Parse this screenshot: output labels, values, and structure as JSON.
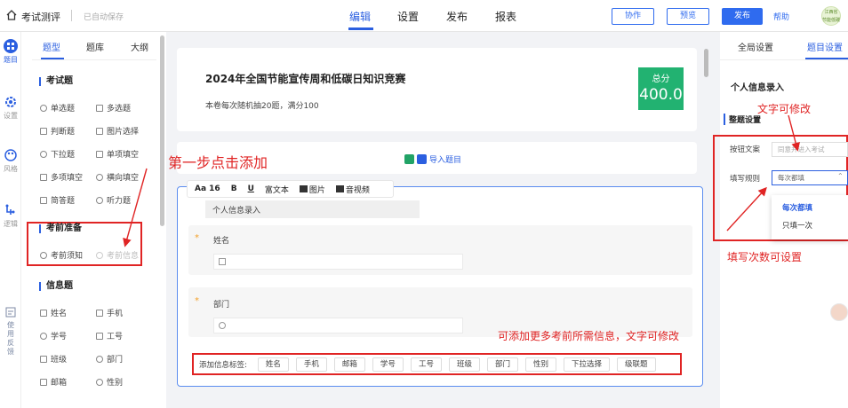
{
  "topbar": {
    "title": "考试测评",
    "saved_status": "已自动保存",
    "nav": [
      "编辑",
      "设置",
      "发布",
      "报表"
    ],
    "active_nav": "编辑",
    "buttons": {
      "collab": "协作",
      "preview": "预览",
      "publish": "发布"
    },
    "help": "帮助",
    "avatar_text": "江西省 节能低碳"
  },
  "rail": [
    {
      "label": "题目",
      "icon": "grid-icon"
    },
    {
      "label": "设置",
      "icon": "gear-icon"
    },
    {
      "label": "风格",
      "icon": "palette-icon"
    },
    {
      "label": "逻辑",
      "icon": "logic-icon"
    }
  ],
  "rail_bottom": "使用反馈",
  "left_panel": {
    "tabs": [
      "题型",
      "题库",
      "大纲"
    ],
    "sections": [
      {
        "title": "考试题",
        "items": [
          "单选题",
          "多选题",
          "判断题",
          "图片选择",
          "下拉题",
          "单项填空",
          "多项填空",
          "横向填空",
          "简答题",
          "听力题"
        ]
      },
      {
        "title": "考前准备",
        "items": [
          "考前须知",
          "考前信息"
        ]
      },
      {
        "title": "信息题",
        "items": [
          "姓名",
          "手机",
          "学号",
          "工号",
          "班级",
          "部门",
          "邮箱",
          "性别"
        ]
      }
    ]
  },
  "exam_card": {
    "title": "2024年全国节能宣传周和低碳日知识竞赛",
    "subtitle": "本卷每次随机抽20题，满分100",
    "score_label": "总分",
    "score_value": "400.0"
  },
  "import_label": "导入题目",
  "editor_toolbar": {
    "font_size": "Aa 16",
    "bold": "B",
    "underline": "U",
    "rich_text": "富文本",
    "image": "图片",
    "audio_video": "音视频"
  },
  "form": {
    "heading": "个人信息录入",
    "fields": [
      {
        "label": "姓名",
        "required": "*"
      },
      {
        "label": "部门",
        "required": "*"
      }
    ],
    "tag_bar_label": "添加信息标签:",
    "tags": [
      "姓名",
      "手机",
      "邮箱",
      "学号",
      "工号",
      "班级",
      "部门",
      "性别",
      "下拉选择",
      "级联题"
    ]
  },
  "right_panel": {
    "tabs": [
      "全局设置",
      "题目设置"
    ],
    "title": "个人信息录入",
    "section": "整题设置",
    "button_text_label": "按钮文案",
    "button_text_value": "同意并进入考试",
    "fill_rule_label": "填写规则",
    "fill_rule_value": "每次都填",
    "fill_rule_options": [
      "每次都填",
      "只填一次"
    ]
  },
  "annotations": {
    "step1": "第一步点击添加",
    "text_editable": "文字可修改",
    "fill_count": "填写次数可设置",
    "more_info": "可添加更多考前所需信息，文字可修改"
  },
  "colors": {
    "accent": "#2b5fe0",
    "score_bg": "#22b271",
    "annotation": "#e02424"
  }
}
